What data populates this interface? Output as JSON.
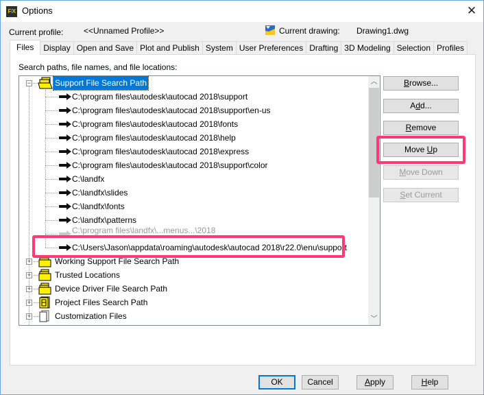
{
  "window": {
    "title": "Options",
    "app_icon": "autocad-landfx-icon",
    "close_icon": "close-icon"
  },
  "header": {
    "current_profile_label": "Current profile:",
    "current_profile_value": "<<Unnamed Profile>>",
    "current_drawing_label": "Current drawing:",
    "current_drawing_value": "Drawing1.dwg"
  },
  "tabs": [
    {
      "label": "Files",
      "active": true
    },
    {
      "label": "Display",
      "active": false
    },
    {
      "label": "Open and Save",
      "active": false
    },
    {
      "label": "Plot and Publish",
      "active": false
    },
    {
      "label": "System",
      "active": false
    },
    {
      "label": "User Preferences",
      "active": false
    },
    {
      "label": "Drafting",
      "active": false
    },
    {
      "label": "3D Modeling",
      "active": false
    },
    {
      "label": "Selection",
      "active": false
    },
    {
      "label": "Profiles",
      "active": false
    }
  ],
  "files_panel": {
    "label": "Search paths, file names, and file locations:",
    "tree": {
      "root": {
        "label": "Support File Search Path",
        "expanded": true,
        "selected": true
      },
      "children": [
        {
          "label": "C:\\program files\\autodesk\\autocad 2018\\support"
        },
        {
          "label": "C:\\program files\\autodesk\\autocad 2018\\support\\en-us"
        },
        {
          "label": "C:\\program files\\autodesk\\autocad 2018\\fonts"
        },
        {
          "label": "C:\\program files\\autodesk\\autocad 2018\\help"
        },
        {
          "label": "C:\\program files\\autodesk\\autocad 2018\\express"
        },
        {
          "label": "C:\\program files\\autodesk\\autocad 2018\\support\\color"
        },
        {
          "label": "C:\\landfx"
        },
        {
          "label": "C:\\landfx\\slides"
        },
        {
          "label": "C:\\landfx\\fonts"
        },
        {
          "label": "C:\\landfx\\patterns"
        },
        {
          "label": "C:\\program files\\landfx\\...menus...\\2018"
        },
        {
          "label": "C:\\Users\\Jason\\appdata\\roaming\\autodesk\\autocad 2018\\r22.0\\enu\\support"
        }
      ],
      "other_nodes": [
        {
          "label": "Working Support File Search Path",
          "icon": "folder-stack-icon"
        },
        {
          "label": "Trusted Locations",
          "icon": "folder-stack-icon"
        },
        {
          "label": "Device Driver File Search Path",
          "icon": "folder-stack-icon"
        },
        {
          "label": "Project Files Search Path",
          "icon": "project-files-icon"
        },
        {
          "label": "Customization Files",
          "icon": "document-stack-icon"
        }
      ]
    },
    "buttons": {
      "browse": {
        "pre": "",
        "key": "B",
        "post": "rowse...",
        "enabled": true
      },
      "add": {
        "pre": "A",
        "key": "d",
        "post": "d...",
        "enabled": true
      },
      "remove": {
        "pre": "",
        "key": "R",
        "post": "emove",
        "enabled": true
      },
      "move_up": {
        "pre": "Move ",
        "key": "U",
        "post": "p",
        "enabled": true
      },
      "move_down": {
        "pre": "",
        "key": "M",
        "post": "ove Down",
        "enabled": false
      },
      "set_current": {
        "pre": "",
        "key": "S",
        "post": "et Current",
        "enabled": false
      }
    },
    "highlight_color": "#ff3973"
  },
  "footer": {
    "ok": "OK",
    "cancel": "Cancel",
    "apply_key": "A",
    "apply_rest": "pply",
    "help_key": "H",
    "help_rest": "elp"
  }
}
